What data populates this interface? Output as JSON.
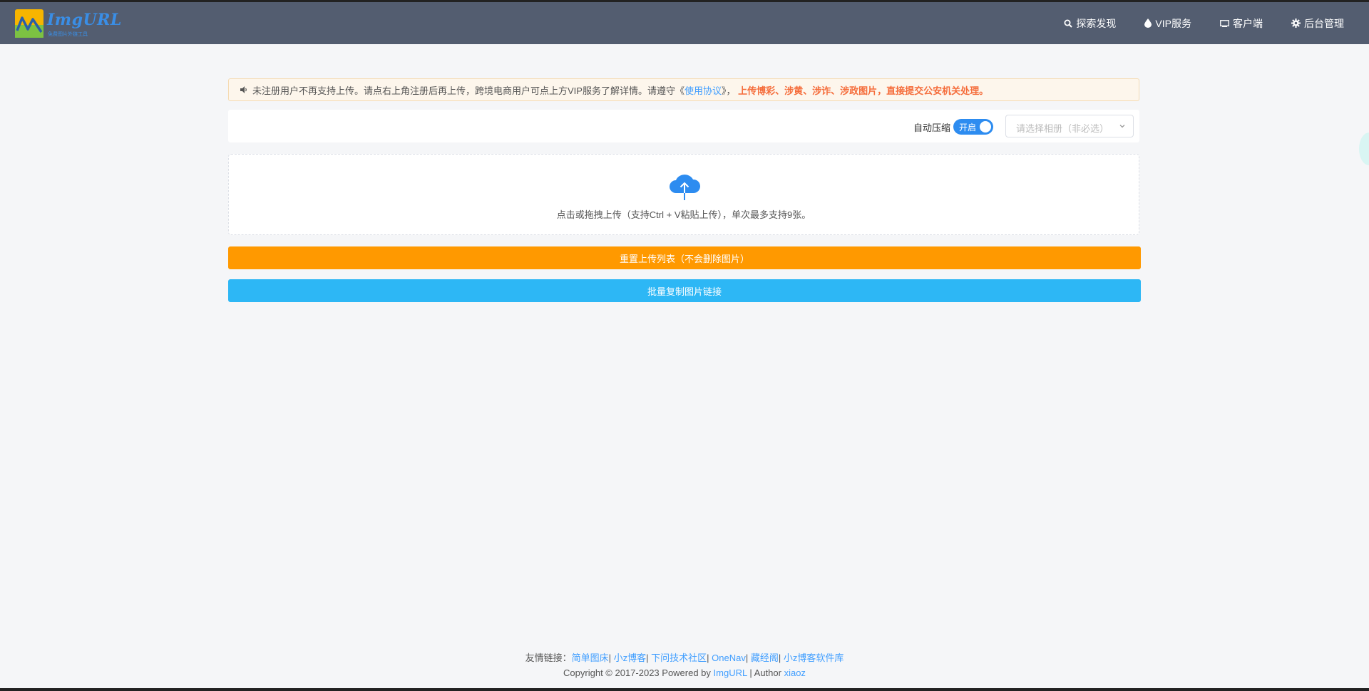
{
  "brand": {
    "name": "ImgURL",
    "tagline": "免费图片外链工具"
  },
  "nav": {
    "items": [
      {
        "label": "探索发现",
        "icon": "search-icon"
      },
      {
        "label": "VIP服务",
        "icon": "drop-icon"
      },
      {
        "label": "客户端",
        "icon": "monitor-icon"
      },
      {
        "label": "后台管理",
        "icon": "gear-icon"
      }
    ]
  },
  "notice": {
    "text_before": "未注册用户不再支持上传。请点右上角注册后再上传，跨境电商用户可点上方VIP服务了解详情。请遵守《",
    "link": "使用协议",
    "text_after": "》，",
    "warning": "上传博彩、涉黄、涉诈、涉政图片，直接提交公安机关处理。"
  },
  "toolbar": {
    "compress_label": "自动压缩",
    "switch_text": "开启",
    "switch_on": true,
    "album_placeholder": "请选择相册（非必选）"
  },
  "upload": {
    "hint": "点击或拖拽上传（支持Ctrl + V粘贴上传），单次最多支持9张。"
  },
  "buttons": {
    "reset": "重置上传列表（不会删除图片）",
    "copy": "批量复制图片链接"
  },
  "footer": {
    "links_label": "友情链接：",
    "links": [
      "简单图床",
      "小z博客",
      "下问技术社区",
      "OneNav",
      "藏经阁",
      "小z博客软件库"
    ],
    "copyright_prefix": "Copyright © 2017-2023 Powered by",
    "powered_by": "ImgURL",
    "author_prefix": "| Author",
    "author": "xiaoz"
  },
  "colors": {
    "navbar": "#535d70",
    "accent": "#409eff",
    "reset_button": "#ff9900",
    "copy_button": "#2db7f5",
    "warning": "#f56c3a"
  }
}
